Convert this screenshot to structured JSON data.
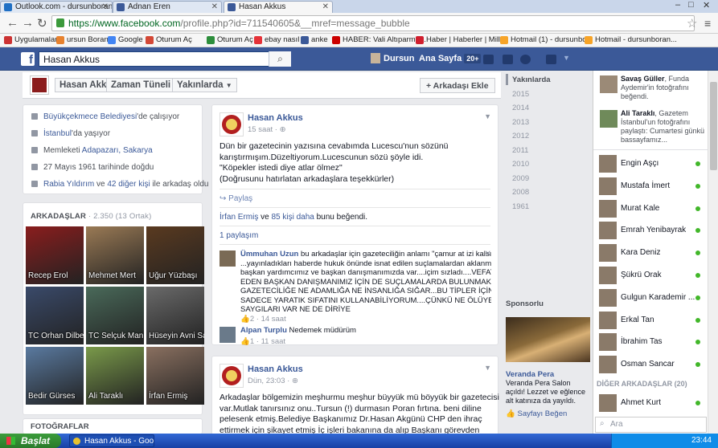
{
  "browser": {
    "tabs": [
      {
        "title": "Outlook.com - dursunboran@",
        "color": "#1f6fc4"
      },
      {
        "title": "Adnan Eren",
        "color": "#3b5998"
      },
      {
        "title": "Hasan Akkus",
        "color": "#3b5998"
      }
    ],
    "url_host": "https://www.facebook.com",
    "url_path": "/profile.php?id=711540605&__mref=message_bubble",
    "bookmarks": [
      {
        "label": "Uygulamalar",
        "color": "#cc3333"
      },
      {
        "label": "ursun Boran",
        "color": "#e8822e"
      },
      {
        "label": "Google",
        "color": "#4285f4"
      },
      {
        "label": "Oturum Aç",
        "color": "#d34836"
      },
      {
        "label": "Oturum Aç",
        "color": "#2d8e3c"
      },
      {
        "label": "ebay nasıl",
        "color": "#e53238"
      },
      {
        "label": "anke",
        "color": "#3b5998"
      },
      {
        "label": "HABER: Vali Altıparma...",
        "color": "#c00"
      },
      {
        "label": "Haber | Haberler | Mill...",
        "color": "#d01f2e"
      },
      {
        "label": "Hotmail (1) - dursunbo...",
        "color": "#f7a428"
      },
      {
        "label": "Hotmail - dursunboran...",
        "color": "#f7a428"
      }
    ]
  },
  "fb": {
    "search_value": "Hasan Akkus",
    "user": "Dursun",
    "home": "Ana Sayfa",
    "home_count": "20+"
  },
  "profile": {
    "name": "Hasan Akkus",
    "timeline": "Zaman Tüneli",
    "about_tab": "Yakınlarda",
    "add_friend": "Arkadaşı Ekle",
    "about": [
      {
        "link": "Büyükçekmece Belediyesi",
        "rest": "'de çalışıyor"
      },
      {
        "link": "İstanbul",
        "rest": "'da yaşıyor"
      },
      {
        "pre": "Memleketi ",
        "link": "Adapazarı, Sakarya",
        "rest": ""
      },
      {
        "pre": "27 Mayıs 1961 tarihinde doğdu",
        "link": "",
        "rest": ""
      },
      {
        "link": "Rabia Yıldırım",
        "rest": " ve ",
        "link2": "42 diğer kişi",
        "rest2": " ile arkadaş oldu"
      }
    ],
    "friends_title": "ARKADAŞLAR",
    "friends_count": " · 2.350 (13 Ortak)",
    "friends": [
      {
        "name": "Recep Erol",
        "color": "#8a1d1d"
      },
      {
        "name": "Mehmet Mert",
        "color": "#9a7a55"
      },
      {
        "name": "Uğur Yüzbaşı",
        "color": "#5a3a20"
      },
      {
        "name": "TC Orhan Dilber",
        "color": "#3a4a6a"
      },
      {
        "name": "TC Selçuk Manioğlu",
        "color": "#4a6a5a"
      },
      {
        "name": "Hüseyin Avni Sandıkçı",
        "color": "#6a6a6a"
      },
      {
        "name": "Bedir Gürses",
        "color": "#5a7aa0"
      },
      {
        "name": "Ali Taraklı",
        "color": "#7a9a4a"
      },
      {
        "name": "İrfan Ermiş",
        "color": "#8a7060"
      }
    ],
    "photos_title": "FOTOĞRAFLAR"
  },
  "post1": {
    "author": "Hasan Akkus",
    "time": "15 saat",
    "lines": [
      "Dün bir gazetecinin yazısına cevabımda Lucescu'nun sözünü",
      "karıştırmışım.Düzeltiyorum.Lucescunun sözü şöyle idi.",
      "\"Köpekler istedi diye atlar ölmez\"",
      "(Doğrusunu hatırlatan arkadaşlara teşekkürler)"
    ],
    "share": "Paylaş",
    "likes_link1": "İrfan Ermiş",
    "likes_mid": " ve ",
    "likes_link2": "85 kişi daha",
    "likes_end": " bunu beğendi.",
    "shares": "1 paylaşım",
    "comments": [
      {
        "author": "Ümmuhan Uzun",
        "lines": [
          " bu arkadaşlar için gazeteciliğin anlamı \"çamur at izi kalsın\"",
          "...yayınladıkları haberde hukuk önünde isnat edilen suçlamalardan aklanmış",
          "başkan yardımcımız ve başkan danışmanımızda var....içim sızladı....VEFAT",
          "EDEN BAŞKAN DANIŞMANIMIZ İÇİN DE SUÇLAMALARDA BULUNMAK NE",
          "GAZETECİLİĞE NE ADAMLIĞA NE İNSANLIĞA SIĞAR...BU TİPLER İÇİN",
          "SADECE YARATIK SIFATINI KULLANABİLİYORUM....ÇÜNKÜ NE ÖLÜYE",
          "SAYGILARI VAR NE DE DİRİYE"
        ],
        "meta": "2 · 14 saat"
      },
      {
        "author": "Alpan Turplu",
        "lines": [
          " Nedemek müdürüm"
        ],
        "meta": "1 · 11 saat"
      }
    ]
  },
  "post2": {
    "author": "Hasan Akkus",
    "time": "Dün, 23:03",
    "lines": [
      "Arkadaşlar bölgemizin meşhurmu meşhur büyyük mü böyyük bir gazetecisi",
      "var.Mutlak tanırsınız onu..Tursun (!) durmasın Poran fırtına. beni diline",
      "pelesenk etmiş.Belediye Başkanımız Dr.Hasan Akgünü CHP den ihraç",
      "ettirmek için şikayet etmiş İç işleri bakanına da alıp Başkanı görevden"
    ]
  },
  "timeline_years": [
    "Yakınlarda",
    "2015",
    "2014",
    "2013",
    "2012",
    "2011",
    "2010",
    "2009",
    "2008",
    "1961"
  ],
  "sponsored": {
    "title": "Sponsorlu",
    "ad_title": "Veranda Pera",
    "ad_text": "Veranda Pera Salon açıldı! Lezzet ve eğlence alt katınıza da yayıldı.",
    "ad_like": "Sayfayı Beğen"
  },
  "ticker": [
    {
      "name": "Savaş Güller",
      "text": ", Funda Aydemir'in fotoğrafını beğendi."
    },
    {
      "name": "Ali Taraklı",
      "text": ", Gazetem İstanbul'un fotoğrafını paylaştı: Cumartesi günkü bassayfamız..."
    }
  ],
  "chat": {
    "buddies": [
      "Engin Aşçı",
      "Mustafa İmert",
      "Murat Kale",
      "Emrah Yenibayrak",
      "Kara Deniz",
      "Şükrü Orak",
      "Gulgun Karademir ...",
      "Erkal Tan",
      "İbrahim Tas",
      "Osman Sancar"
    ],
    "section": "DİĞER ARKADAŞLAR (20)",
    "others": [
      "Ahmet Kurt"
    ],
    "search_placeholder": "Ara"
  },
  "taskbar": {
    "start": "Başlat",
    "item": "Hasan Akkus - Google...",
    "clock": "23:44"
  }
}
